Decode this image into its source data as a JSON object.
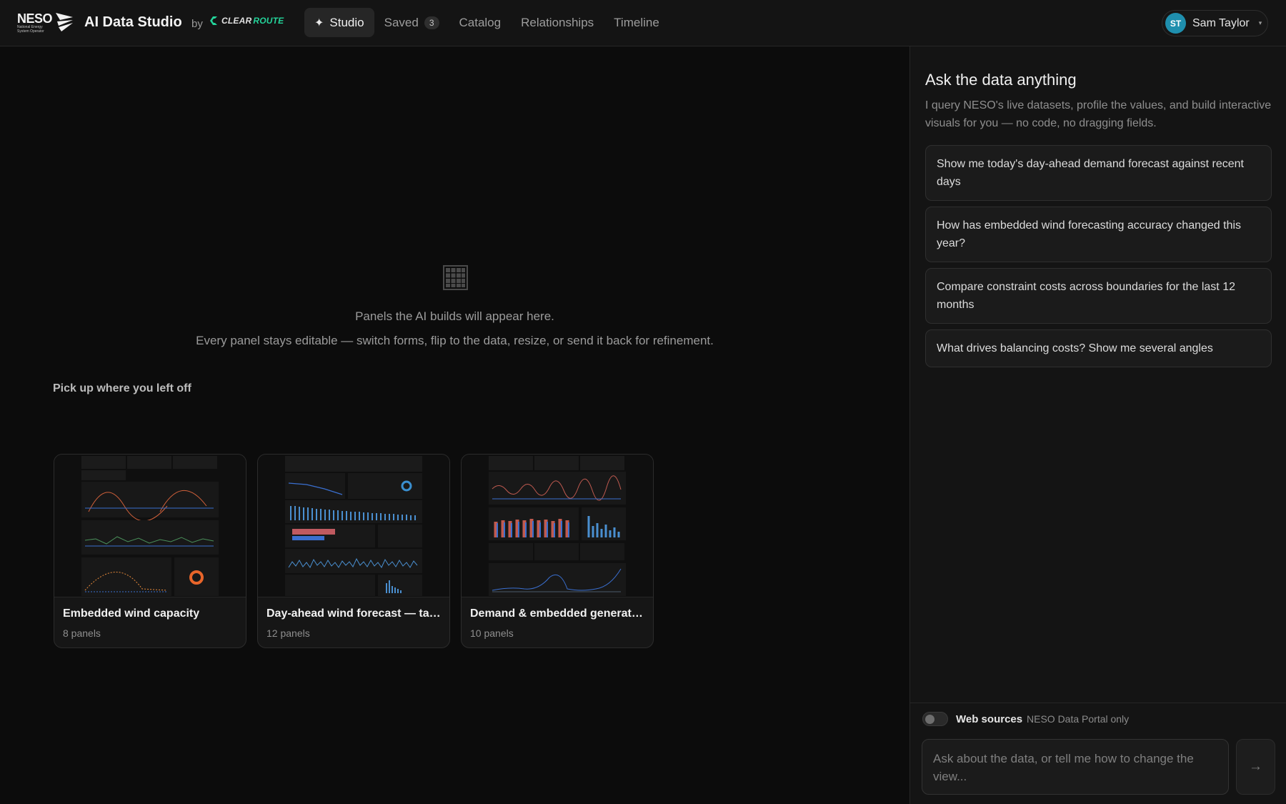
{
  "header": {
    "logo": {
      "word": "NESO",
      "sub": [
        "National Energy",
        "System Operator"
      ]
    },
    "app_title": "AI Data Studio",
    "by": "by",
    "partner": {
      "part1": "CLEAR",
      "part2": "ROUTE"
    },
    "nav": [
      {
        "label": "Studio",
        "icon": "sparkle-icon",
        "active": true
      },
      {
        "label": "Saved",
        "badge": "3"
      },
      {
        "label": "Catalog"
      },
      {
        "label": "Relationships"
      },
      {
        "label": "Timeline"
      }
    ],
    "user": {
      "initials": "ST",
      "name": "Sam Taylor",
      "caret": "▾"
    }
  },
  "main": {
    "empty_icon": "grid-icon",
    "empty_line1": "Panels the AI builds will appear here.",
    "empty_line2": "Every panel stays editable — switch forms, flip to the data, resize, or send it back for refinement.",
    "recent_title": "Pick up where you left off",
    "recent": [
      {
        "name": "Embedded wind capacity",
        "count": "8 panels"
      },
      {
        "name": "Day-ahead wind forecast — targ...",
        "count": "12 panels"
      },
      {
        "name": "Demand & embedded generatio...",
        "count": "10 panels"
      }
    ]
  },
  "side": {
    "title": "Ask the data anything",
    "description": "I query NESO's live datasets, profile the values, and build interactive visuals for you — no code, no dragging fields.",
    "suggestions": [
      "Show me today's day-ahead demand forecast against recent days",
      "How has embedded wind forecasting accuracy changed this year?",
      "Compare constraint costs across boundaries for the last 12 months",
      "What drives balancing costs? Show me several angles"
    ],
    "web_sources_label": "Web sources",
    "web_sources_note": "NESO Data Portal only",
    "input_placeholder": "Ask about the data, or tell me how to change the view...",
    "send_icon": "→"
  },
  "colors": {
    "accent": "#24d39a",
    "avatar": "#1f8fae",
    "background": "#0c0c0c",
    "panel": "#141414"
  }
}
